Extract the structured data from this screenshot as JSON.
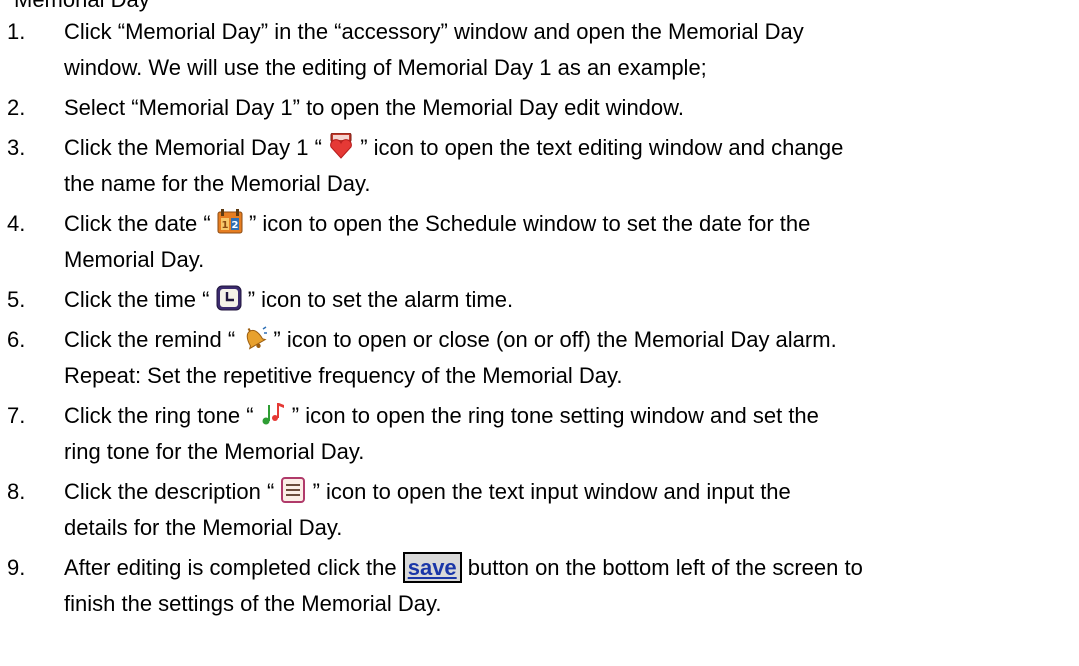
{
  "partial_top": "Memorial Day",
  "steps": [
    {
      "num": "1.",
      "line1": "Click “Memorial Day” in the “accessory” window and open the Memorial Day",
      "line2": "window. We will use the editing of Memorial Day 1 as an example;"
    },
    {
      "num": "2.",
      "line1": "Select “Memorial Day 1” to open the Memorial Day edit window."
    },
    {
      "num": "3.",
      "pre": "Click the Memorial Day 1 “",
      "icon": "heart-calendar-icon",
      "post": "” icon to open the text editing window and change",
      "line2": "the name for the Memorial Day."
    },
    {
      "num": "4.",
      "pre": "Click the date “",
      "icon": "date-calendar-icon",
      "post": "” icon to open the Schedule window to set the date for the",
      "line2": "Memorial Day."
    },
    {
      "num": "5.",
      "pre": "Click the time “",
      "icon": "clock-icon",
      "post": "” icon to set the alarm time."
    },
    {
      "num": "6.",
      "pre": "Click the remind “",
      "icon": "bell-icon",
      "post": "” icon to open or close (on or off)  the Memorial Day alarm.",
      "line2": "Repeat: Set the repetitive frequency of the Memorial Day."
    },
    {
      "num": "7.",
      "pre": "Click the ring tone “",
      "icon": "music-note-icon",
      "post": "” icon to open the ring tone setting window and set the",
      "line2": "ring tone for the Memorial Day."
    },
    {
      "num": "8.",
      "pre": "Click the description “",
      "icon": "description-icon",
      "post": "” icon to open the text input window and input the",
      "line2": "details for the Memorial Day."
    },
    {
      "num": "9.",
      "pre": "After editing is completed click the ",
      "button": "save",
      "post": " button on the bottom left of the screen to",
      "line2": "finish the settings of the Memorial Day."
    }
  ]
}
